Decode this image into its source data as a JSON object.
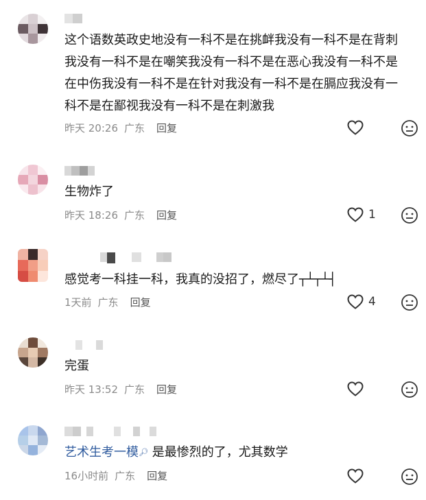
{
  "comments": [
    {
      "body": "这个语数英政史地没有一科不是在挑衅我没有一科不是在背刺我没有一科不是在嘲笑我没有一科不是在恶心我没有一科不是在中伤我没有一科不是在针对我没有一科不是在膈应我没有一科不是在鄙视我没有一科不是在刺激我",
      "time": "昨天 20:26",
      "location": "广东",
      "reply": "回复",
      "likes": ""
    },
    {
      "body": "生物炸了",
      "time": "昨天 18:26",
      "location": "广东",
      "reply": "回复",
      "likes": "1"
    },
    {
      "body": "感觉考一科挂一科，我真的没招了，燃尽了┬┴┬┴┤",
      "time": "1天前",
      "location": "广东",
      "reply": "回复",
      "likes": "4"
    },
    {
      "body": "完蛋",
      "time": "昨天 13:52",
      "location": "广东",
      "reply": "回复",
      "likes": ""
    },
    {
      "reply_to": "艺术生考一模",
      "body": "是最惨烈的了，尤其数学",
      "time": "16小时前",
      "location": "广东",
      "reply": "回复",
      "likes": ""
    }
  ],
  "icons": {
    "like": "heart-outline-icon",
    "dislike": "meh-face-icon"
  },
  "colors": {
    "meta": "#8a8a8a",
    "reply_link": "#2f5b9e"
  }
}
